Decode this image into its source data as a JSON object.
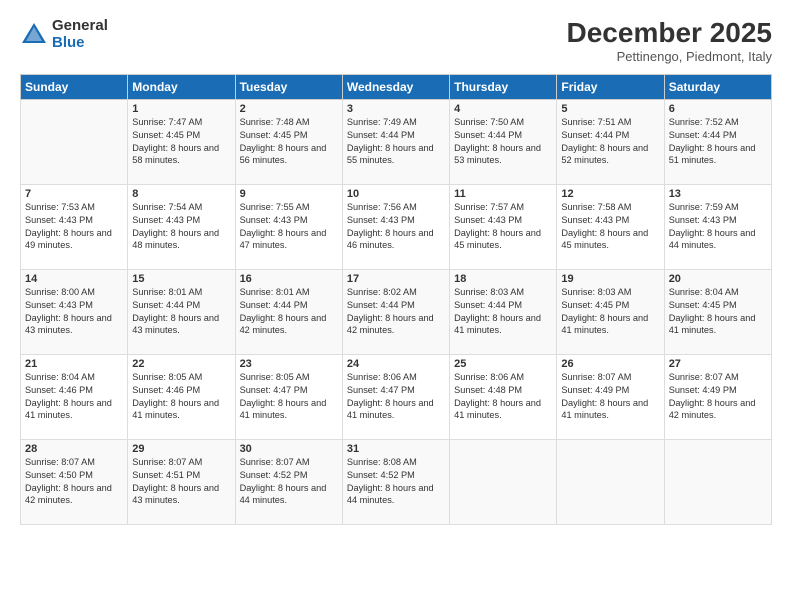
{
  "logo": {
    "general": "General",
    "blue": "Blue"
  },
  "header": {
    "title": "December 2025",
    "location": "Pettinengo, Piedmont, Italy"
  },
  "days_of_week": [
    "Sunday",
    "Monday",
    "Tuesday",
    "Wednesday",
    "Thursday",
    "Friday",
    "Saturday"
  ],
  "weeks": [
    [
      {
        "day": "",
        "sunrise": "",
        "sunset": "",
        "daylight": ""
      },
      {
        "day": "1",
        "sunrise": "Sunrise: 7:47 AM",
        "sunset": "Sunset: 4:45 PM",
        "daylight": "Daylight: 8 hours and 58 minutes."
      },
      {
        "day": "2",
        "sunrise": "Sunrise: 7:48 AM",
        "sunset": "Sunset: 4:45 PM",
        "daylight": "Daylight: 8 hours and 56 minutes."
      },
      {
        "day": "3",
        "sunrise": "Sunrise: 7:49 AM",
        "sunset": "Sunset: 4:44 PM",
        "daylight": "Daylight: 8 hours and 55 minutes."
      },
      {
        "day": "4",
        "sunrise": "Sunrise: 7:50 AM",
        "sunset": "Sunset: 4:44 PM",
        "daylight": "Daylight: 8 hours and 53 minutes."
      },
      {
        "day": "5",
        "sunrise": "Sunrise: 7:51 AM",
        "sunset": "Sunset: 4:44 PM",
        "daylight": "Daylight: 8 hours and 52 minutes."
      },
      {
        "day": "6",
        "sunrise": "Sunrise: 7:52 AM",
        "sunset": "Sunset: 4:44 PM",
        "daylight": "Daylight: 8 hours and 51 minutes."
      }
    ],
    [
      {
        "day": "7",
        "sunrise": "Sunrise: 7:53 AM",
        "sunset": "Sunset: 4:43 PM",
        "daylight": "Daylight: 8 hours and 49 minutes."
      },
      {
        "day": "8",
        "sunrise": "Sunrise: 7:54 AM",
        "sunset": "Sunset: 4:43 PM",
        "daylight": "Daylight: 8 hours and 48 minutes."
      },
      {
        "day": "9",
        "sunrise": "Sunrise: 7:55 AM",
        "sunset": "Sunset: 4:43 PM",
        "daylight": "Daylight: 8 hours and 47 minutes."
      },
      {
        "day": "10",
        "sunrise": "Sunrise: 7:56 AM",
        "sunset": "Sunset: 4:43 PM",
        "daylight": "Daylight: 8 hours and 46 minutes."
      },
      {
        "day": "11",
        "sunrise": "Sunrise: 7:57 AM",
        "sunset": "Sunset: 4:43 PM",
        "daylight": "Daylight: 8 hours and 45 minutes."
      },
      {
        "day": "12",
        "sunrise": "Sunrise: 7:58 AM",
        "sunset": "Sunset: 4:43 PM",
        "daylight": "Daylight: 8 hours and 45 minutes."
      },
      {
        "day": "13",
        "sunrise": "Sunrise: 7:59 AM",
        "sunset": "Sunset: 4:43 PM",
        "daylight": "Daylight: 8 hours and 44 minutes."
      }
    ],
    [
      {
        "day": "14",
        "sunrise": "Sunrise: 8:00 AM",
        "sunset": "Sunset: 4:43 PM",
        "daylight": "Daylight: 8 hours and 43 minutes."
      },
      {
        "day": "15",
        "sunrise": "Sunrise: 8:01 AM",
        "sunset": "Sunset: 4:44 PM",
        "daylight": "Daylight: 8 hours and 43 minutes."
      },
      {
        "day": "16",
        "sunrise": "Sunrise: 8:01 AM",
        "sunset": "Sunset: 4:44 PM",
        "daylight": "Daylight: 8 hours and 42 minutes."
      },
      {
        "day": "17",
        "sunrise": "Sunrise: 8:02 AM",
        "sunset": "Sunset: 4:44 PM",
        "daylight": "Daylight: 8 hours and 42 minutes."
      },
      {
        "day": "18",
        "sunrise": "Sunrise: 8:03 AM",
        "sunset": "Sunset: 4:44 PM",
        "daylight": "Daylight: 8 hours and 41 minutes."
      },
      {
        "day": "19",
        "sunrise": "Sunrise: 8:03 AM",
        "sunset": "Sunset: 4:45 PM",
        "daylight": "Daylight: 8 hours and 41 minutes."
      },
      {
        "day": "20",
        "sunrise": "Sunrise: 8:04 AM",
        "sunset": "Sunset: 4:45 PM",
        "daylight": "Daylight: 8 hours and 41 minutes."
      }
    ],
    [
      {
        "day": "21",
        "sunrise": "Sunrise: 8:04 AM",
        "sunset": "Sunset: 4:46 PM",
        "daylight": "Daylight: 8 hours and 41 minutes."
      },
      {
        "day": "22",
        "sunrise": "Sunrise: 8:05 AM",
        "sunset": "Sunset: 4:46 PM",
        "daylight": "Daylight: 8 hours and 41 minutes."
      },
      {
        "day": "23",
        "sunrise": "Sunrise: 8:05 AM",
        "sunset": "Sunset: 4:47 PM",
        "daylight": "Daylight: 8 hours and 41 minutes."
      },
      {
        "day": "24",
        "sunrise": "Sunrise: 8:06 AM",
        "sunset": "Sunset: 4:47 PM",
        "daylight": "Daylight: 8 hours and 41 minutes."
      },
      {
        "day": "25",
        "sunrise": "Sunrise: 8:06 AM",
        "sunset": "Sunset: 4:48 PM",
        "daylight": "Daylight: 8 hours and 41 minutes."
      },
      {
        "day": "26",
        "sunrise": "Sunrise: 8:07 AM",
        "sunset": "Sunset: 4:49 PM",
        "daylight": "Daylight: 8 hours and 41 minutes."
      },
      {
        "day": "27",
        "sunrise": "Sunrise: 8:07 AM",
        "sunset": "Sunset: 4:49 PM",
        "daylight": "Daylight: 8 hours and 42 minutes."
      }
    ],
    [
      {
        "day": "28",
        "sunrise": "Sunrise: 8:07 AM",
        "sunset": "Sunset: 4:50 PM",
        "daylight": "Daylight: 8 hours and 42 minutes."
      },
      {
        "day": "29",
        "sunrise": "Sunrise: 8:07 AM",
        "sunset": "Sunset: 4:51 PM",
        "daylight": "Daylight: 8 hours and 43 minutes."
      },
      {
        "day": "30",
        "sunrise": "Sunrise: 8:07 AM",
        "sunset": "Sunset: 4:52 PM",
        "daylight": "Daylight: 8 hours and 44 minutes."
      },
      {
        "day": "31",
        "sunrise": "Sunrise: 8:08 AM",
        "sunset": "Sunset: 4:52 PM",
        "daylight": "Daylight: 8 hours and 44 minutes."
      },
      {
        "day": "",
        "sunrise": "",
        "sunset": "",
        "daylight": ""
      },
      {
        "day": "",
        "sunrise": "",
        "sunset": "",
        "daylight": ""
      },
      {
        "day": "",
        "sunrise": "",
        "sunset": "",
        "daylight": ""
      }
    ]
  ]
}
